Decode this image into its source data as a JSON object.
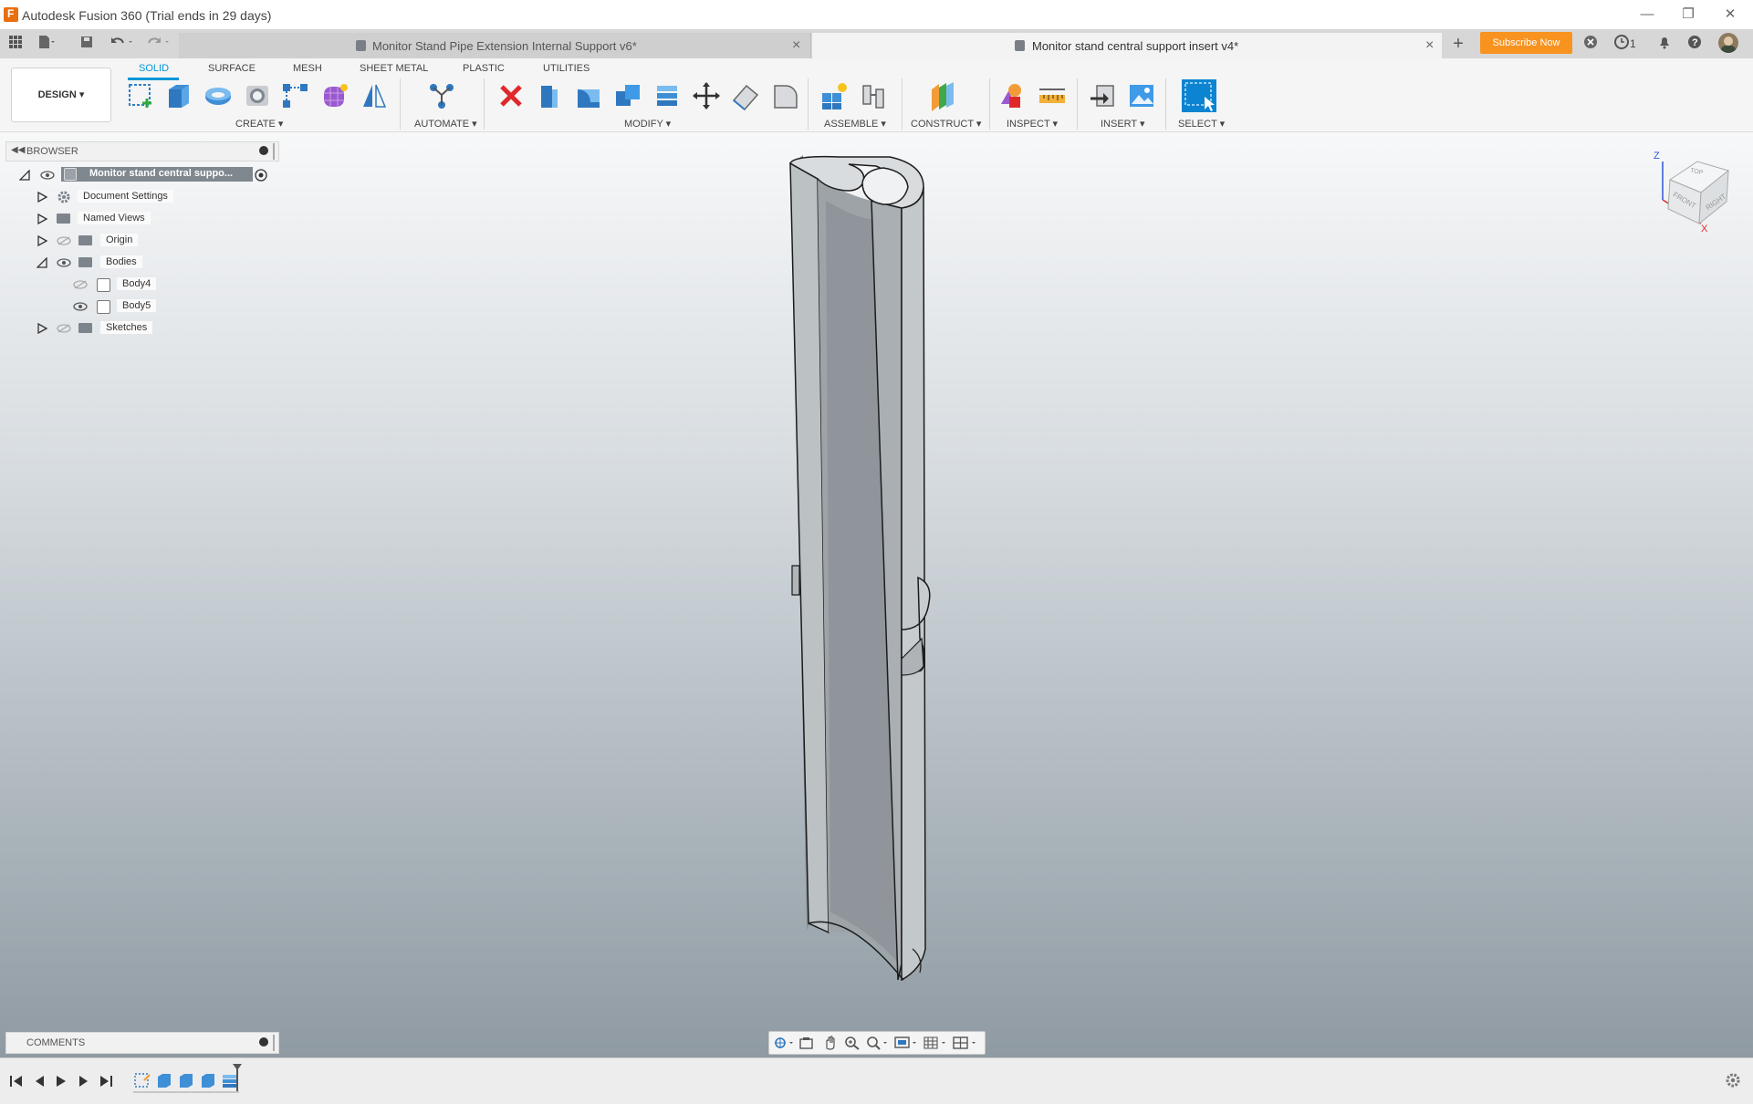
{
  "app": {
    "title": "Autodesk Fusion 360 (Trial ends in 29 days)",
    "accent_color": "#0696d7",
    "brand_color": "#e8700f"
  },
  "document_tabs": [
    {
      "label": "Monitor Stand Pipe Extension Internal Support v6*",
      "active": false
    },
    {
      "label": "Monitor stand central support insert v4*",
      "active": true
    }
  ],
  "header_actions": {
    "subscribe_label": "Subscribe Now",
    "subscribe_color": "#f7931e",
    "jobs_count": "1"
  },
  "toolbar": {
    "workspace": "DESIGN",
    "workspace_tabs": [
      "SOLID",
      "SURFACE",
      "MESH",
      "SHEET METAL",
      "PLASTIC",
      "UTILITIES"
    ],
    "active_tab": "SOLID",
    "groups": [
      "CREATE",
      "AUTOMATE",
      "MODIFY",
      "ASSEMBLE",
      "CONSTRUCT",
      "INSPECT",
      "INSERT",
      "SELECT"
    ]
  },
  "browser": {
    "title": "BROWSER",
    "root": "Monitor stand central suppo...",
    "items": [
      {
        "label": "Document Settings",
        "icon": "gear-icon"
      },
      {
        "label": "Named Views",
        "icon": "folder-icon"
      },
      {
        "label": "Origin",
        "icon": "folder-icon"
      },
      {
        "label": "Bodies",
        "icon": "folder-icon"
      },
      {
        "label": "Body4",
        "icon": "body-icon"
      },
      {
        "label": "Body5",
        "icon": "body-icon"
      },
      {
        "label": "Sketches",
        "icon": "folder-icon"
      }
    ]
  },
  "comments": {
    "title": "COMMENTS"
  },
  "viewcube": {
    "top": "TOP",
    "front": "FRONT",
    "right": "RIGHT",
    "axis_z": "Z",
    "axis_x": "X"
  }
}
